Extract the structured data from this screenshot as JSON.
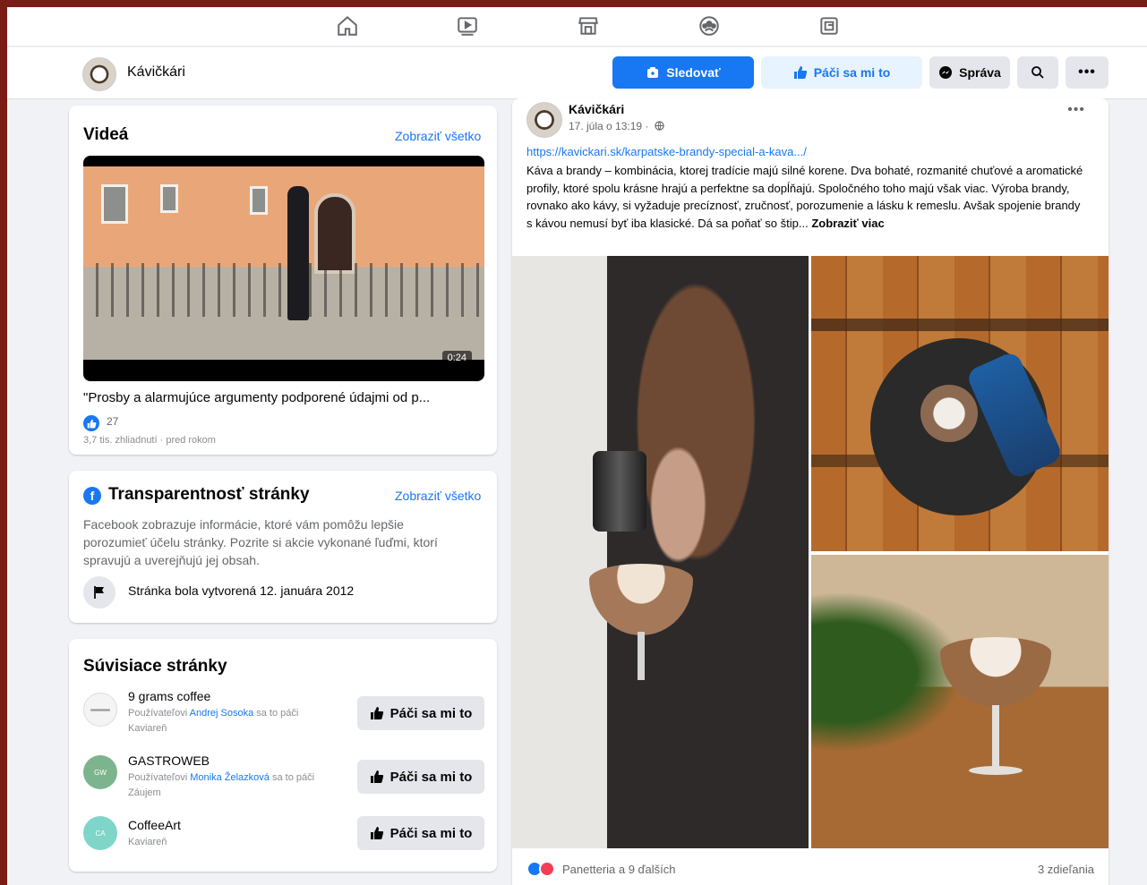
{
  "header": {
    "page_name": "Kávičkári",
    "follow_label": "Sledovať",
    "like_label": "Páči sa mi to",
    "message_label": "Správa",
    "more_label": "•••"
  },
  "videos": {
    "title": "Videá",
    "see_all": "Zobraziť všetko",
    "duration": "0:24",
    "caption": "\"Prosby a alarmujúce argumenty podporené údajmi od p...",
    "reaction_count": "27",
    "meta": "3,7 tis. zhliadnutí · pred rokom"
  },
  "transparency": {
    "title": "Transparentnosť stránky",
    "see_all": "Zobraziť všetko",
    "description": "Facebook zobrazuje informácie, ktoré vám pomôžu lepšie porozumieť účelu stránky. Pozrite si akcie vykonané ľuďmi, ktorí spravujú a uverejňujú jej obsah.",
    "created": "Stránka bola vytvorená 12. januára 2012"
  },
  "related": {
    "title": "Súvisiace stránky",
    "button_label": "Páči sa mi to",
    "items": [
      {
        "name": "9 grams coffee",
        "line_pre": "Používateľovi ",
        "line_link": "Andrej Sosoka",
        "line_post": " sa to páči",
        "category": "Kaviareň"
      },
      {
        "name": "GASTROWEB",
        "line_pre": "Používateľovi ",
        "line_link": "Monika Želazková",
        "line_post": " sa to páči",
        "category": "Záujem"
      },
      {
        "name": "CoffeeArt",
        "category": "Kaviareň"
      }
    ]
  },
  "post": {
    "author": "Kávičkári",
    "time": "17. júla o 13:19 ·",
    "more": "•••",
    "link": "https://kavickari.sk/karpatske-brandy-special-a-kava.../",
    "text": "Káva a brandy – kombinácia, ktorej tradície majú silné korene. Dva bohaté, rozmanité chuťové a aromatické profily, ktoré spolu krásne hrajú a perfektne sa dopĺňajú. Spoločného toho majú však viac. Výroba brandy, rovnako ako kávy, si vyžaduje precíznosť, zručnosť, porozumenie a lásku k remeslu. Avšak spojenie brandy s kávou nemusí byť iba klasické. Dá sa poňať so štip...",
    "see_more": "Zobraziť viac",
    "reactions": "Panetteria a 9 ďalších",
    "shares": "3 zdieľania"
  },
  "colors": {
    "frame": "#7b1d17",
    "accent": "#1877f2",
    "accent_light": "#e7f3ff",
    "background": "#f0f2f5"
  },
  "icons": {
    "nav": [
      "home-icon",
      "watch-icon",
      "marketplace-icon",
      "groups-icon",
      "gaming-icon"
    ]
  }
}
